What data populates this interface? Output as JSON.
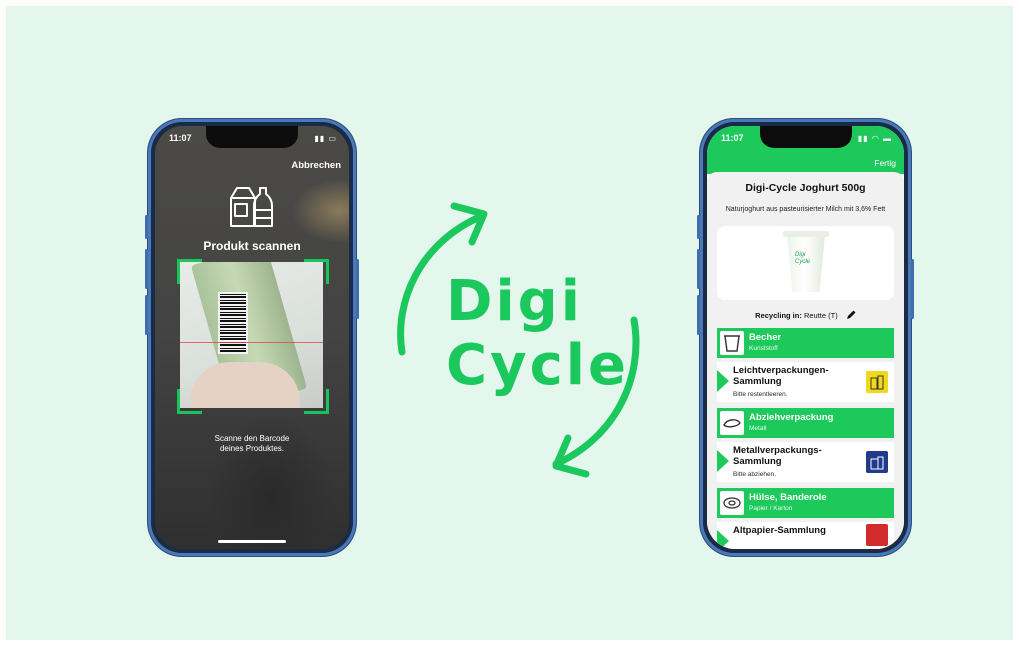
{
  "colors": {
    "background": "#e3f7ec",
    "accent_green": "#1ec95c",
    "phone_frame": "#4a79b9",
    "scan_corner": "#19c45a",
    "bin_yellow": "#f2d81a",
    "bin_blue": "#213a8c",
    "bin_red": "#d12b2b"
  },
  "scanner_phone": {
    "status_time": "11:07",
    "cancel_label": "Abbrechen",
    "icon": "product-packages-icon",
    "title": "Produkt scannen",
    "hint_line1": "Scanne den Barcode",
    "hint_line2": "deines Produktes."
  },
  "logo": {
    "line1": "Digi",
    "line2": "Cycle"
  },
  "result_phone": {
    "status_time": "11:07",
    "done_label": "Fertig",
    "product_title": "Digi-Cycle Joghurt 500g",
    "product_description": "Naturjoghurt aus pasteurisierter Milch mit 3,6% Fett",
    "cup_label_line1": "Digi",
    "cup_label_line2": "Cycle",
    "recycling_label": "Recycling in:",
    "recycling_location": "Reutte (T)",
    "items": [
      {
        "type": "component",
        "title": "Becher",
        "subtitle": "Kunststoff",
        "icon": "cup-icon"
      },
      {
        "type": "disposal",
        "title": "Leichtverpackungen-Sammlung",
        "subtitle": "Bitte restentleeren.",
        "icon": "yellow-bin-icon"
      },
      {
        "type": "component",
        "title": "Abziehverpackung",
        "subtitle": "Metall",
        "icon": "lid-icon"
      },
      {
        "type": "disposal",
        "title": "Metallverpackungs-Sammlung",
        "subtitle": "Bitte abziehen.",
        "icon": "blue-bin-icon"
      },
      {
        "type": "component",
        "title": "Hülse, Banderole",
        "subtitle": "Papier / Karton",
        "icon": "sleeve-icon"
      },
      {
        "type": "disposal",
        "title": "Altpapier-Sammlung",
        "icon": "red-bin-icon"
      }
    ]
  }
}
